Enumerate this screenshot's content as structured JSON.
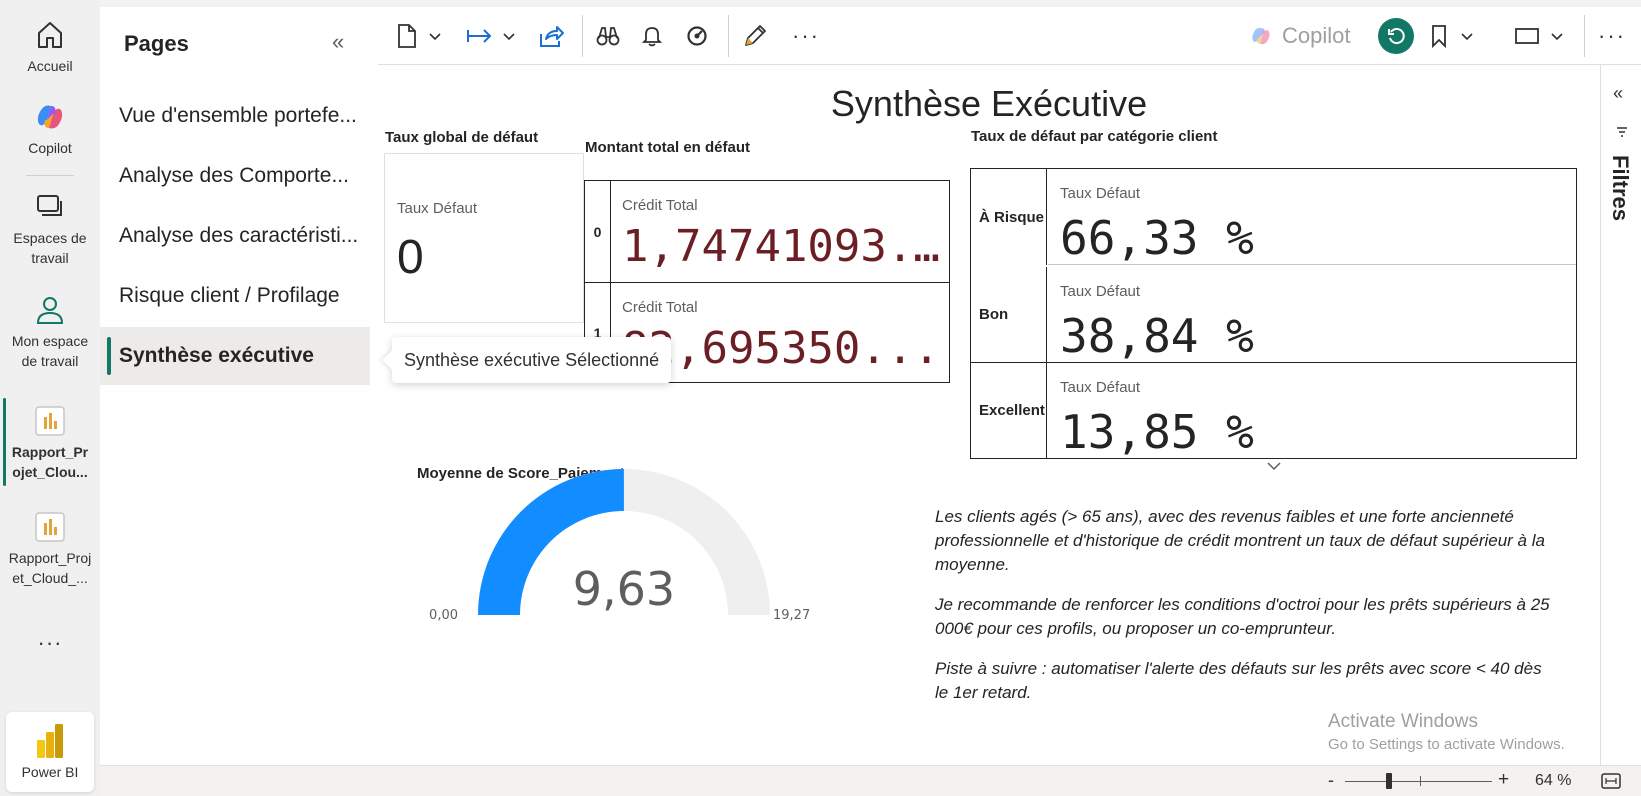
{
  "rail": {
    "home": "Accueil",
    "copilot": "Copilot",
    "workspaces": "Espaces de travail",
    "myspace": "Mon espace de travail",
    "report1": "Rapport_Projet_Clou...",
    "report2": "Rapport_Projet_Cloud_...",
    "more": "···",
    "product": "Power BI"
  },
  "pages": {
    "title": "Pages",
    "items": [
      "Vue d'ensemble portefe...",
      "Analyse des Comporte...",
      "Analyse des caractéristi...",
      "Risque client / Profilage",
      "Synthèse exécutive"
    ],
    "active_index": 4,
    "tooltip": "Synthèse exécutive Sélectionné"
  },
  "toolbar": {
    "copilot": "Copilot"
  },
  "report": {
    "title": "Synthèse Exécutive",
    "card_global": {
      "title": "Taux global de défaut",
      "label": "Taux Défaut",
      "value": "0"
    },
    "card_montant": {
      "title": "Montant total en défaut",
      "rows": [
        {
          "key": "0",
          "label": "Crédit Total",
          "value": "1,74741093..."
        },
        {
          "key": "1",
          "label": "Crédit Total",
          "value": "82,695350..."
        }
      ]
    },
    "card_categorie": {
      "title": "Taux de défaut par catégorie client",
      "rows": [
        {
          "key": "À Risque",
          "label": "Taux Défaut",
          "value": "66,33 %"
        },
        {
          "key": "Bon",
          "label": "Taux Défaut",
          "value": "38,84 %"
        },
        {
          "key": "Excellent",
          "label": "Taux Défaut",
          "value": "13,85 %"
        }
      ]
    },
    "gauge": {
      "title": "Moyenne de Score_Paiement",
      "value_label": "9,63",
      "min_label": "0,00",
      "max_label": "19,27",
      "value": 9.63,
      "min": 0,
      "max": 19.27,
      "fill_color": "#118dff",
      "track_color": "#f0efef"
    },
    "narrative": [
      "Les clients agés (> 65 ans), avec des revenus faibles et une forte ancienneté professionnelle et d'historique de crédit montrent un taux de défaut supérieur à la moyenne.",
      "Je recommande de renforcer les conditions d'octroi pour les prêts supérieurs à 25 000€ pour ces profils, ou proposer un co-emprunteur.",
      "Piste à suivre : automatiser l'alerte des défauts sur les prêts avec score < 40 dès le 1er retard."
    ]
  },
  "watermark": {
    "line1": "Activate Windows",
    "line2": "Go to Settings to activate Windows."
  },
  "filters": {
    "label": "Filtres"
  },
  "status": {
    "zoom": "64 %"
  },
  "colors": {
    "accent": "#117865",
    "value_dark_red": "#6b1f24"
  }
}
